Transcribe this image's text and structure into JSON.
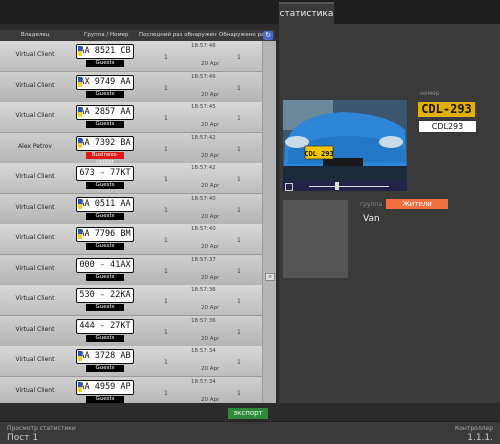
{
  "tab": "статистика",
  "columns": [
    "Владелец",
    "Группа / Номер",
    "Последний раз обнаружен",
    "Обнаружено раз"
  ],
  "rows": [
    {
      "owner": "Virtual Client",
      "plate": "AA 8521 CB",
      "plate_style": "ua",
      "group": "Guests",
      "group_color": "black",
      "count_a": "1",
      "time": "18:57:46",
      "date": "20 Apr",
      "count_b": "1"
    },
    {
      "owner": "Virtual Client",
      "plate": "AX 9749 AA",
      "plate_style": "ua",
      "group": "Guests",
      "group_color": "black",
      "count_a": "1",
      "time": "18:57:46",
      "date": "20 Apr",
      "count_b": "1"
    },
    {
      "owner": "Virtual Client",
      "plate": "AA 2857 AA",
      "plate_style": "ua",
      "group": "Guests",
      "group_color": "black",
      "count_a": "1",
      "time": "18:57:45",
      "date": "20 Apr",
      "count_b": "1"
    },
    {
      "owner": "Alex Petrov",
      "plate": "AA 7392 BA",
      "plate_style": "ua",
      "group": "Business-center",
      "group_color": "red",
      "count_a": "1",
      "time": "18:57:42",
      "date": "20 Apr",
      "count_b": "1"
    },
    {
      "owner": "Virtual Client",
      "plate": "673 - 77KT",
      "plate_style": "plain",
      "group": "Guests",
      "group_color": "black",
      "count_a": "1",
      "time": "18:57:42",
      "date": "20 Apr",
      "count_b": "1"
    },
    {
      "owner": "Virtual Client",
      "plate": "AA 0511 AA",
      "plate_style": "ua",
      "group": "Guests",
      "group_color": "black",
      "count_a": "1",
      "time": "18:57:40",
      "date": "20 Apr",
      "count_b": "1"
    },
    {
      "owner": "Virtual Client",
      "plate": "AA 7796 BM",
      "plate_style": "ua",
      "group": "Guests",
      "group_color": "black",
      "count_a": "1",
      "time": "18:57:40",
      "date": "20 Apr",
      "count_b": "1"
    },
    {
      "owner": "Virtual Client",
      "plate": "000 - 41AX",
      "plate_style": "plain",
      "group": "Guests",
      "group_color": "black",
      "count_a": "1",
      "time": "18:57:37",
      "date": "20 Apr",
      "count_b": "1"
    },
    {
      "owner": "Virtual Client",
      "plate": "530 - 22KA",
      "plate_style": "plain",
      "group": "Guests",
      "group_color": "black",
      "count_a": "1",
      "time": "18:57:36",
      "date": "20 Apr",
      "count_b": "1"
    },
    {
      "owner": "Virtual Client",
      "plate": "444 - 27KT",
      "plate_style": "plain",
      "group": "Guests",
      "group_color": "black",
      "count_a": "1",
      "time": "18:57:36",
      "date": "20 Apr",
      "count_b": "1"
    },
    {
      "owner": "Virtual Client",
      "plate": "AA 3728 AB",
      "plate_style": "ua",
      "group": "Guests",
      "group_color": "black",
      "count_a": "1",
      "time": "18:57:34",
      "date": "20 Apr",
      "count_b": "1"
    },
    {
      "owner": "Virtual Client",
      "plate": "AA 4959 AP",
      "plate_style": "ua",
      "group": "Guests",
      "group_color": "black",
      "count_a": "1",
      "time": "18:57:34",
      "date": "20 Apr",
      "count_b": "1"
    }
  ],
  "detail": {
    "number_label": "номер",
    "plate_big": "CDL-293",
    "plate_text": "CDL293",
    "group_label": "группа",
    "group_value": "Жители",
    "vehicle_type": "Van",
    "photo_plate": "CDL 293"
  },
  "export_label": "экспорт",
  "status": {
    "left_label": "Просмотр статистики",
    "left_value": "Пост 1",
    "right_label": "Контроллер",
    "right_value": "1.1.1."
  },
  "colors": {
    "group_orange": "#f07040",
    "plate_yellow": "#e4b000",
    "export_green": "#2e8a3a"
  }
}
